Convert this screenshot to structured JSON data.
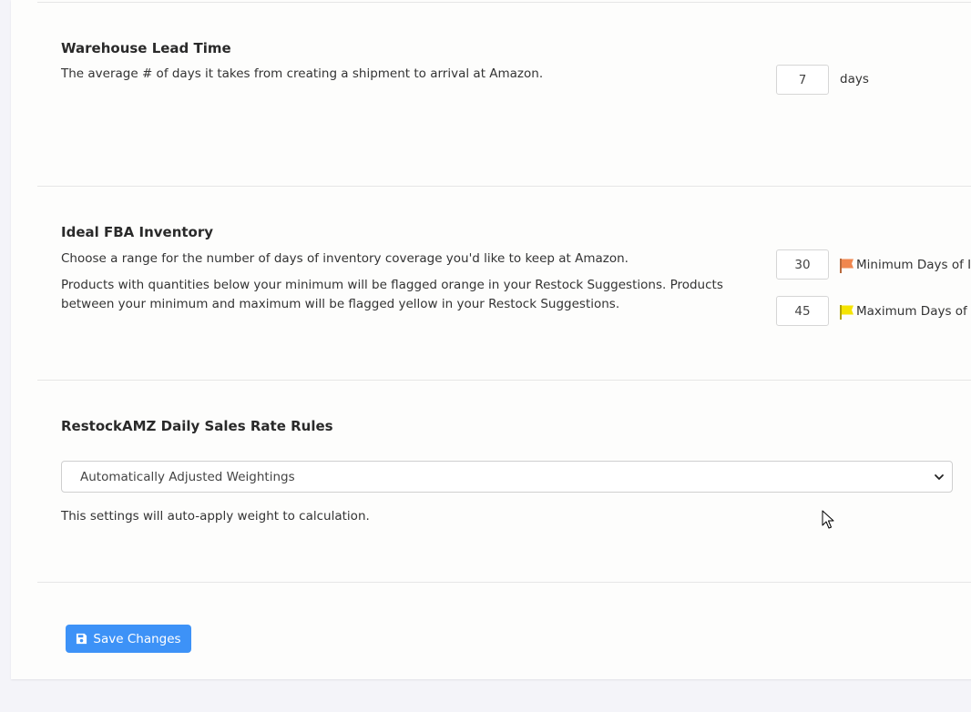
{
  "lead_time": {
    "title": "Warehouse Lead Time",
    "description": "The average # of days it takes from creating a shipment to arrival at Amazon.",
    "value": "7",
    "unit": "days"
  },
  "ideal_inventory": {
    "title": "Ideal FBA Inventory",
    "description_1": "Choose a range for the number of days of inventory coverage you'd like to keep at Amazon.",
    "description_2": "Products with quantities below your minimum will be flagged orange in your Restock Suggestions. Products between your minimum and maximum will be flagged yellow in your Restock Suggestions.",
    "minimum_value": "30",
    "minimum_label": "Minimum Days of I",
    "minimum_flag_color": "#f0874f",
    "maximum_value": "45",
    "maximum_label": "Maximum Days of",
    "maximum_flag_color": "#f5e400"
  },
  "sales_rate": {
    "title": "RestockAMZ Daily Sales Rate Rules",
    "selected_option": "Automatically Adjusted Weightings",
    "help_text": "This settings will auto-apply weight to calculation."
  },
  "actions": {
    "save_label": "Save Changes",
    "save_color": "#3d92f7"
  },
  "icons": {
    "save": "floppy-disk-icon",
    "dropdown": "chevron-down-icon",
    "flag": "flag-icon"
  }
}
